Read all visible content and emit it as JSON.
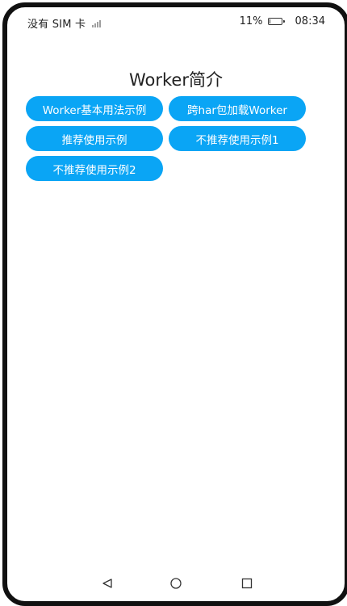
{
  "status_bar": {
    "carrier": "没有 SIM 卡",
    "battery_percent": "11%",
    "battery_level": 0.11,
    "time": "08:34"
  },
  "page": {
    "title": "Worker简介"
  },
  "buttons": [
    {
      "label": "Worker基本用法示例"
    },
    {
      "label": "跨har包加载Worker"
    },
    {
      "label": "推荐使用示例"
    },
    {
      "label": "不推荐使用示例1"
    },
    {
      "label": "不推荐使用示例2"
    }
  ],
  "colors": {
    "button_bg": "#0aa5f5",
    "button_text": "#ffffff",
    "title_text": "#222222",
    "device_frame": "#111111"
  },
  "nav_bar": {
    "back_icon": "back-triangle-icon",
    "home_icon": "home-circle-icon",
    "recents_icon": "recents-square-icon"
  }
}
